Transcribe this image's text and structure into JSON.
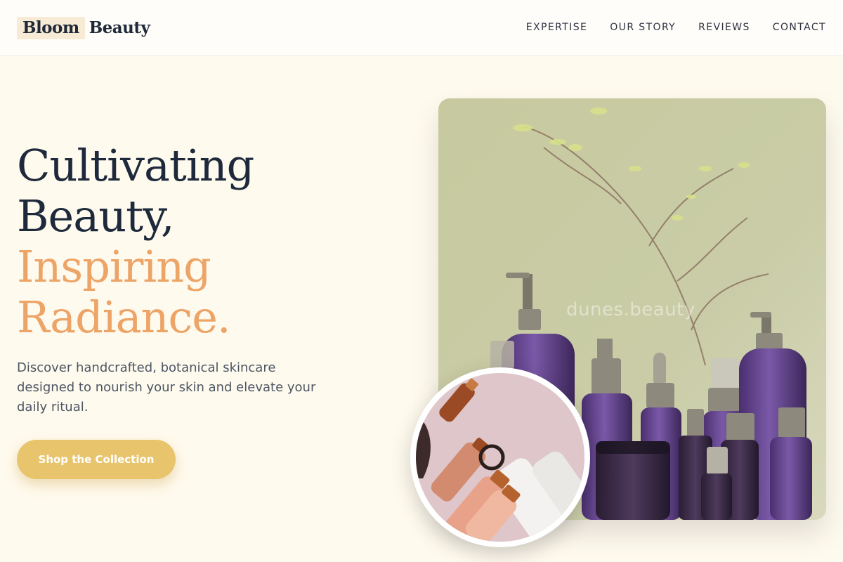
{
  "header": {
    "logo_word1": "Bloom",
    "logo_word2": "Beauty",
    "nav": [
      "EXPERTISE",
      "OUR STORY",
      "REVIEWS",
      "CONTACT"
    ]
  },
  "hero": {
    "title_line1": "Cultivating",
    "title_line2": "Beauty,",
    "title_line3": "Inspiring",
    "title_line4": "Radiance.",
    "description": "Discover handcrafted, botanical skincare designed to nourish your skin and elevate your daily ritual.",
    "cta_label": "Shop the Collection"
  },
  "images": {
    "main_watermark": "dunes.beauty"
  },
  "colors": {
    "background": "#fffaee",
    "accent_text": "#eda467",
    "button": "#e8c56c",
    "heading": "#1e2a3c"
  }
}
